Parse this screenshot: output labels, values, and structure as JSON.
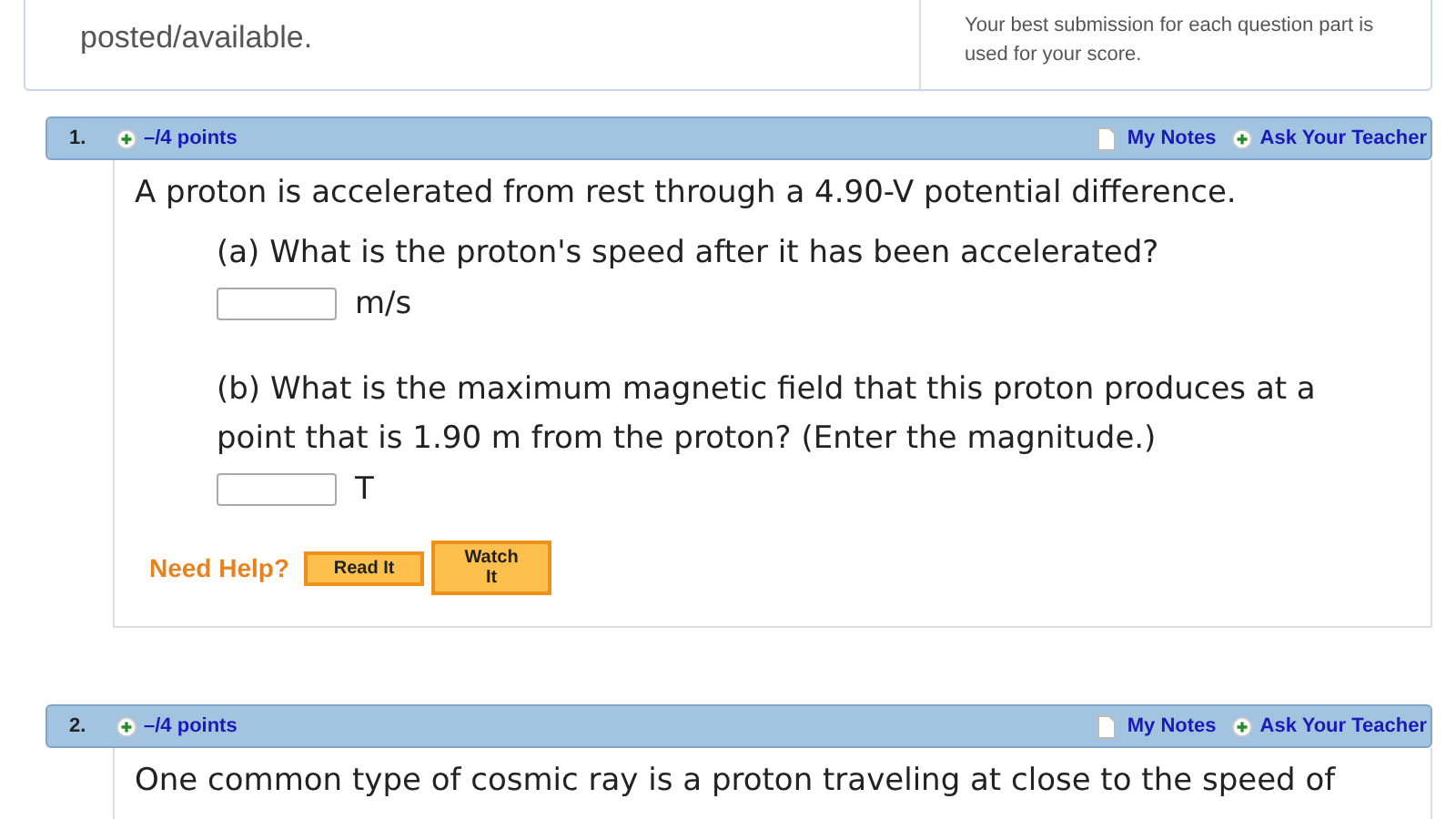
{
  "info_box": {
    "left_text": "posted/available.",
    "right_text": "Your best submission for each question part is used for your score."
  },
  "questions": [
    {
      "number": "1.",
      "points": "–/4 points",
      "notes_link": "My Notes",
      "ask_link": "Ask Your Teacher",
      "intro": "A proton is accelerated from rest through a 4.90-V potential difference.",
      "parts": [
        {
          "prompt": "(a) What is the proton's speed after it has been accelerated?",
          "unit": "m/s"
        },
        {
          "prompt": "(b) What is the maximum magnetic field that this proton produces at a point that is 1.90 m from the proton? (Enter the magnitude.)",
          "unit": "T"
        }
      ],
      "help": {
        "label": "Need Help?",
        "buttons": [
          "Read It",
          "Watch It"
        ]
      }
    },
    {
      "number": "2.",
      "points": "–/4 points",
      "notes_link": "My Notes",
      "ask_link": "Ask Your Teacher",
      "intro": "One common type of cosmic ray is a proton traveling at close to the speed of"
    }
  ]
}
